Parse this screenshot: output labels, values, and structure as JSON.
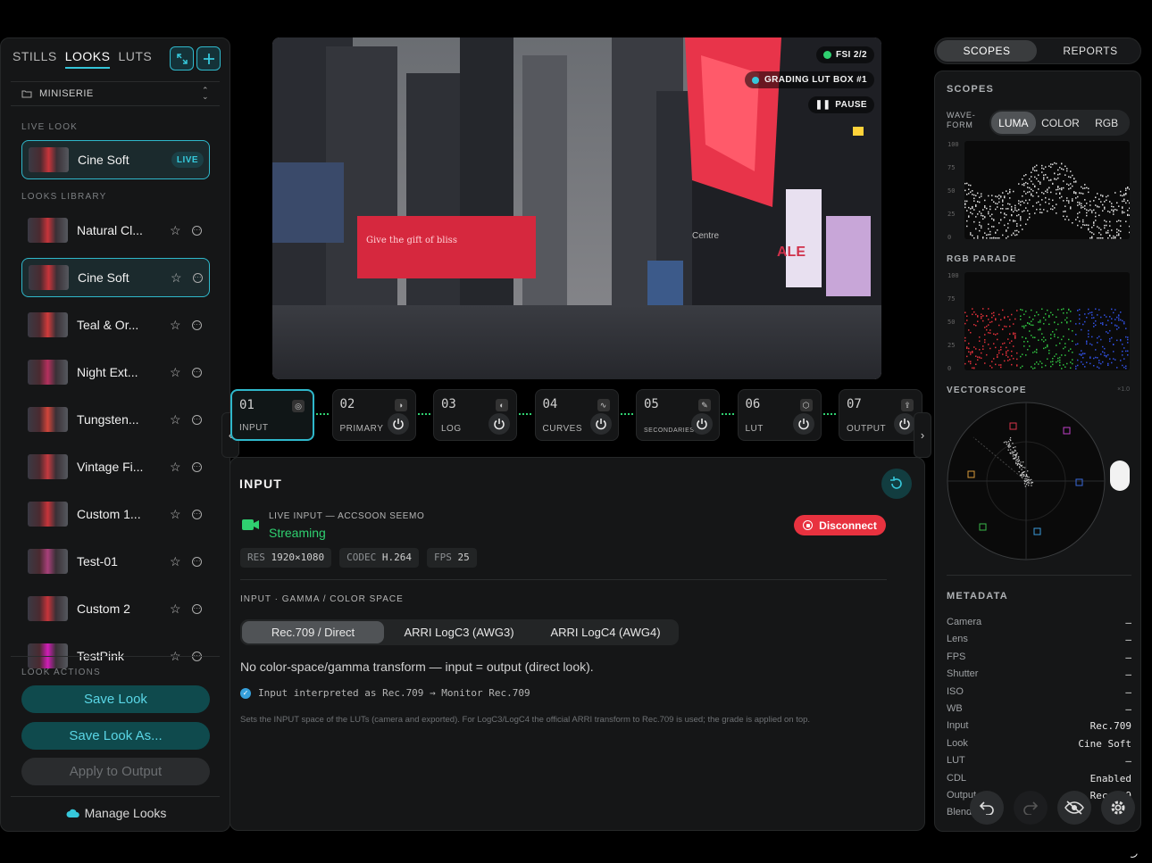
{
  "left": {
    "tabs": [
      "STILLS",
      "LOOKS",
      "LUTS"
    ],
    "active_tab": "LOOKS",
    "project": "MINISERIE",
    "live_look_heading": "LIVE LOOK",
    "live_look": {
      "name": "Cine Soft",
      "badge": "LIVE"
    },
    "library_heading": "LOOKS LIBRARY",
    "library": [
      {
        "name": "Natural Cl...",
        "selected": false,
        "tint": "#c8343a"
      },
      {
        "name": "Cine Soft",
        "selected": true,
        "tint": "#c8343a"
      },
      {
        "name": "Teal & Or...",
        "selected": false,
        "tint": "#d23b3b"
      },
      {
        "name": "Night Ext...",
        "selected": false,
        "tint": "#b5305e"
      },
      {
        "name": "Tungsten...",
        "selected": false,
        "tint": "#d2453a"
      },
      {
        "name": "Vintage Fi...",
        "selected": false,
        "tint": "#c53a3f"
      },
      {
        "name": "Custom 1...",
        "selected": false,
        "tint": "#c8343a"
      },
      {
        "name": "Test-01",
        "selected": false,
        "tint": "#a8407a"
      },
      {
        "name": "Custom 2",
        "selected": false,
        "tint": "#c8343a"
      },
      {
        "name": "TestPink",
        "selected": false,
        "tint": "#d21db8"
      }
    ],
    "actions_heading": "LOOK ACTIONS",
    "save_look": "Save Look",
    "save_look_as": "Save Look As...",
    "apply_output": "Apply to Output",
    "manage_looks": "Manage Looks"
  },
  "video": {
    "fsi": "FSI 2/2",
    "lut_box": "GRADING LUT BOX #1",
    "pause": "PAUSE",
    "billboard_text": "Give the gift of bliss",
    "sign_sale": "ALE",
    "sign_centre": "Centre"
  },
  "pipeline": [
    {
      "num": "01",
      "label": "INPUT",
      "selected": true
    },
    {
      "num": "02",
      "label": "PRIMARY",
      "selected": false
    },
    {
      "num": "03",
      "label": "LOG",
      "selected": false
    },
    {
      "num": "04",
      "label": "CURVES",
      "selected": false
    },
    {
      "num": "05",
      "label": "SECONDARIES",
      "selected": false
    },
    {
      "num": "06",
      "label": "LUT",
      "selected": false
    },
    {
      "num": "07",
      "label": "OUTPUT",
      "selected": false
    }
  ],
  "input": {
    "title": "INPUT",
    "source_label": "LIVE INPUT — ACCSOON SEEMO",
    "status": "Streaming",
    "disconnect": "Disconnect",
    "res_key": "RES",
    "res_val": "1920×1080",
    "codec_key": "CODEC",
    "codec_val": "H.264",
    "fps_key": "FPS",
    "fps_val": "25",
    "space_heading": "INPUT · GAMMA / COLOR SPACE",
    "options": [
      "Rec.709 / Direct",
      "ARRI LogC3 (AWG3)",
      "ARRI LogC4 (AWG4)"
    ],
    "selected_option": "Rec.709 / Direct",
    "description": "No color-space/gamma transform — input = output (direct look).",
    "interpretation": "Input interpreted as Rec.709 → Monitor Rec.709",
    "footnote": "Sets the INPUT space of the LUTs (camera and exported). For LogC3/LogC4 the official ARRI transform to Rec.709 is used; the grade is applied on top."
  },
  "right": {
    "tabs": [
      "SCOPES",
      "REPORTS"
    ],
    "active_tab": "SCOPES",
    "scopes_heading": "SCOPES",
    "waveform_label": "WAVE-\nFORM",
    "waveform_modes": [
      "LUMA",
      "COLOR",
      "RGB"
    ],
    "waveform_active": "LUMA",
    "y_ticks": [
      "100",
      "75",
      "50",
      "25",
      "0"
    ],
    "parade_heading": "RGB PARADE",
    "vectorscope_heading": "VECTORSCOPE",
    "vectorscope_zoom": "×1.0",
    "metadata_heading": "METADATA",
    "metadata": [
      {
        "key": "Camera",
        "value": "—"
      },
      {
        "key": "Lens",
        "value": "—"
      },
      {
        "key": "FPS",
        "value": "—"
      },
      {
        "key": "Shutter",
        "value": "—"
      },
      {
        "key": "ISO",
        "value": "—"
      },
      {
        "key": "WB",
        "value": "—"
      },
      {
        "key": "Input",
        "value": "Rec.709"
      },
      {
        "key": "Look",
        "value": "Cine Soft"
      },
      {
        "key": "LUT",
        "value": "—"
      },
      {
        "key": "CDL",
        "value": "Enabled"
      },
      {
        "key": "Output",
        "value": "Rec.709"
      },
      {
        "key": "Blend",
        "value": ""
      }
    ]
  },
  "colors": {
    "accent": "#2fb8cb",
    "live_green": "#2fd070",
    "danger": "#e8323f",
    "teal_button": "#0f4a4d"
  }
}
